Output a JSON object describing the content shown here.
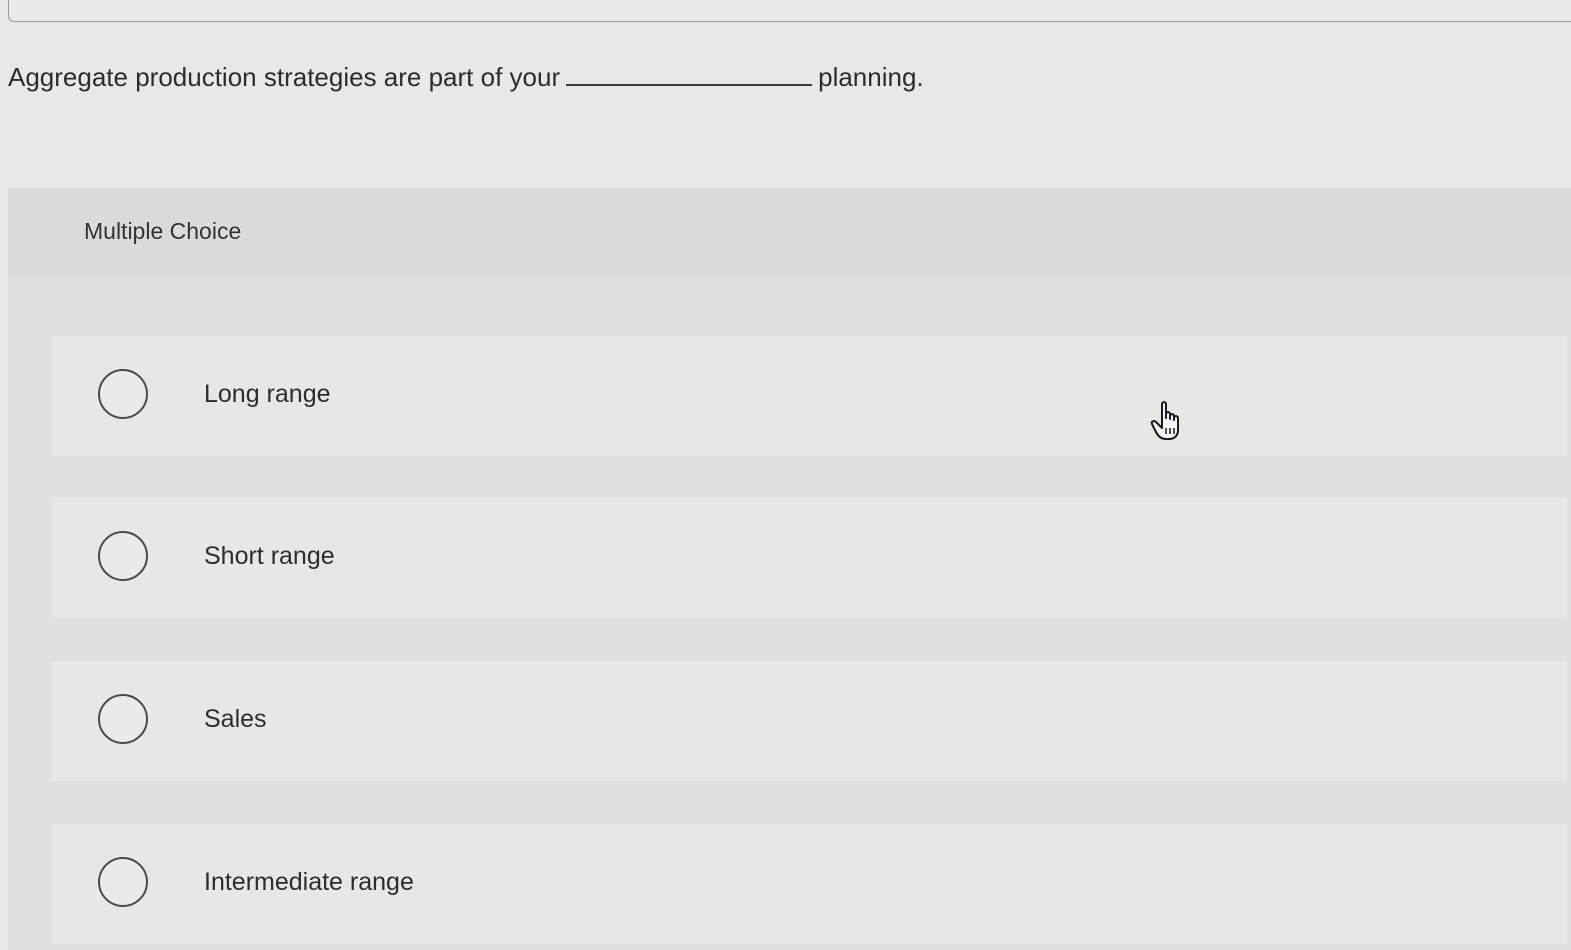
{
  "question": {
    "text_before": "Aggregate production strategies are part of your",
    "text_after": "planning."
  },
  "multiple_choice": {
    "label": "Multiple Choice",
    "options": [
      {
        "label": "Long range",
        "selected": false
      },
      {
        "label": "Short range",
        "selected": false
      },
      {
        "label": "Sales",
        "selected": false
      },
      {
        "label": "Intermediate range",
        "selected": false
      }
    ]
  },
  "cursor": {
    "icon": "hand-pointer-icon"
  }
}
